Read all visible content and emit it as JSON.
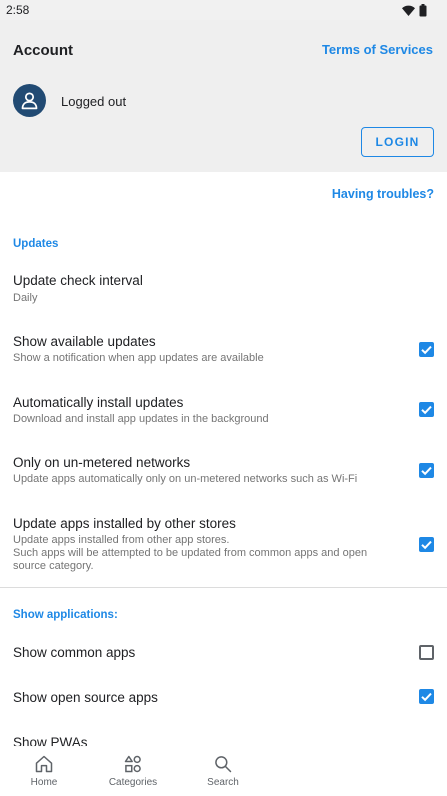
{
  "status_bar": {
    "time": "2:58",
    "icons": [
      "wifi-icon",
      "battery-icon"
    ]
  },
  "account": {
    "title": "Account",
    "terms_link": "Terms of Services",
    "avatar_icon": "person-icon",
    "status": "Logged out",
    "login_button": "LOGIN"
  },
  "having_troubles": "Having troubles?",
  "updates": {
    "header": "Updates",
    "interval": {
      "title": "Update check interval",
      "value": "Daily"
    },
    "items": [
      {
        "title": "Show available updates",
        "subtitle": "Show a notification when app updates are available",
        "checked": true
      },
      {
        "title": "Automatically install updates",
        "subtitle": "Download and install app updates in the background",
        "checked": true
      },
      {
        "title": "Only on un-metered networks",
        "subtitle": "Update apps automatically only on un-metered networks such as Wi-Fi",
        "checked": true
      },
      {
        "title": "Update apps installed by other stores",
        "subtitle_line1": "Update apps installed from other app stores.",
        "subtitle_line2": "Such apps will be attempted to be updated from common apps and open source category.",
        "checked": true
      }
    ]
  },
  "show_applications": {
    "header": "Show applications:",
    "items": [
      {
        "title": "Show common apps",
        "checked": false
      },
      {
        "title": "Show open source apps",
        "checked": true
      },
      {
        "title": "Show PWAs"
      }
    ]
  },
  "bottom_nav": [
    {
      "label": "Home",
      "icon": "home-icon"
    },
    {
      "label": "Categories",
      "icon": "categories-icon"
    },
    {
      "label": "Search",
      "icon": "search-icon"
    }
  ],
  "colors": {
    "accent": "#1e88e5",
    "avatar_bg": "#214a73",
    "header_bg": "#efefef"
  }
}
